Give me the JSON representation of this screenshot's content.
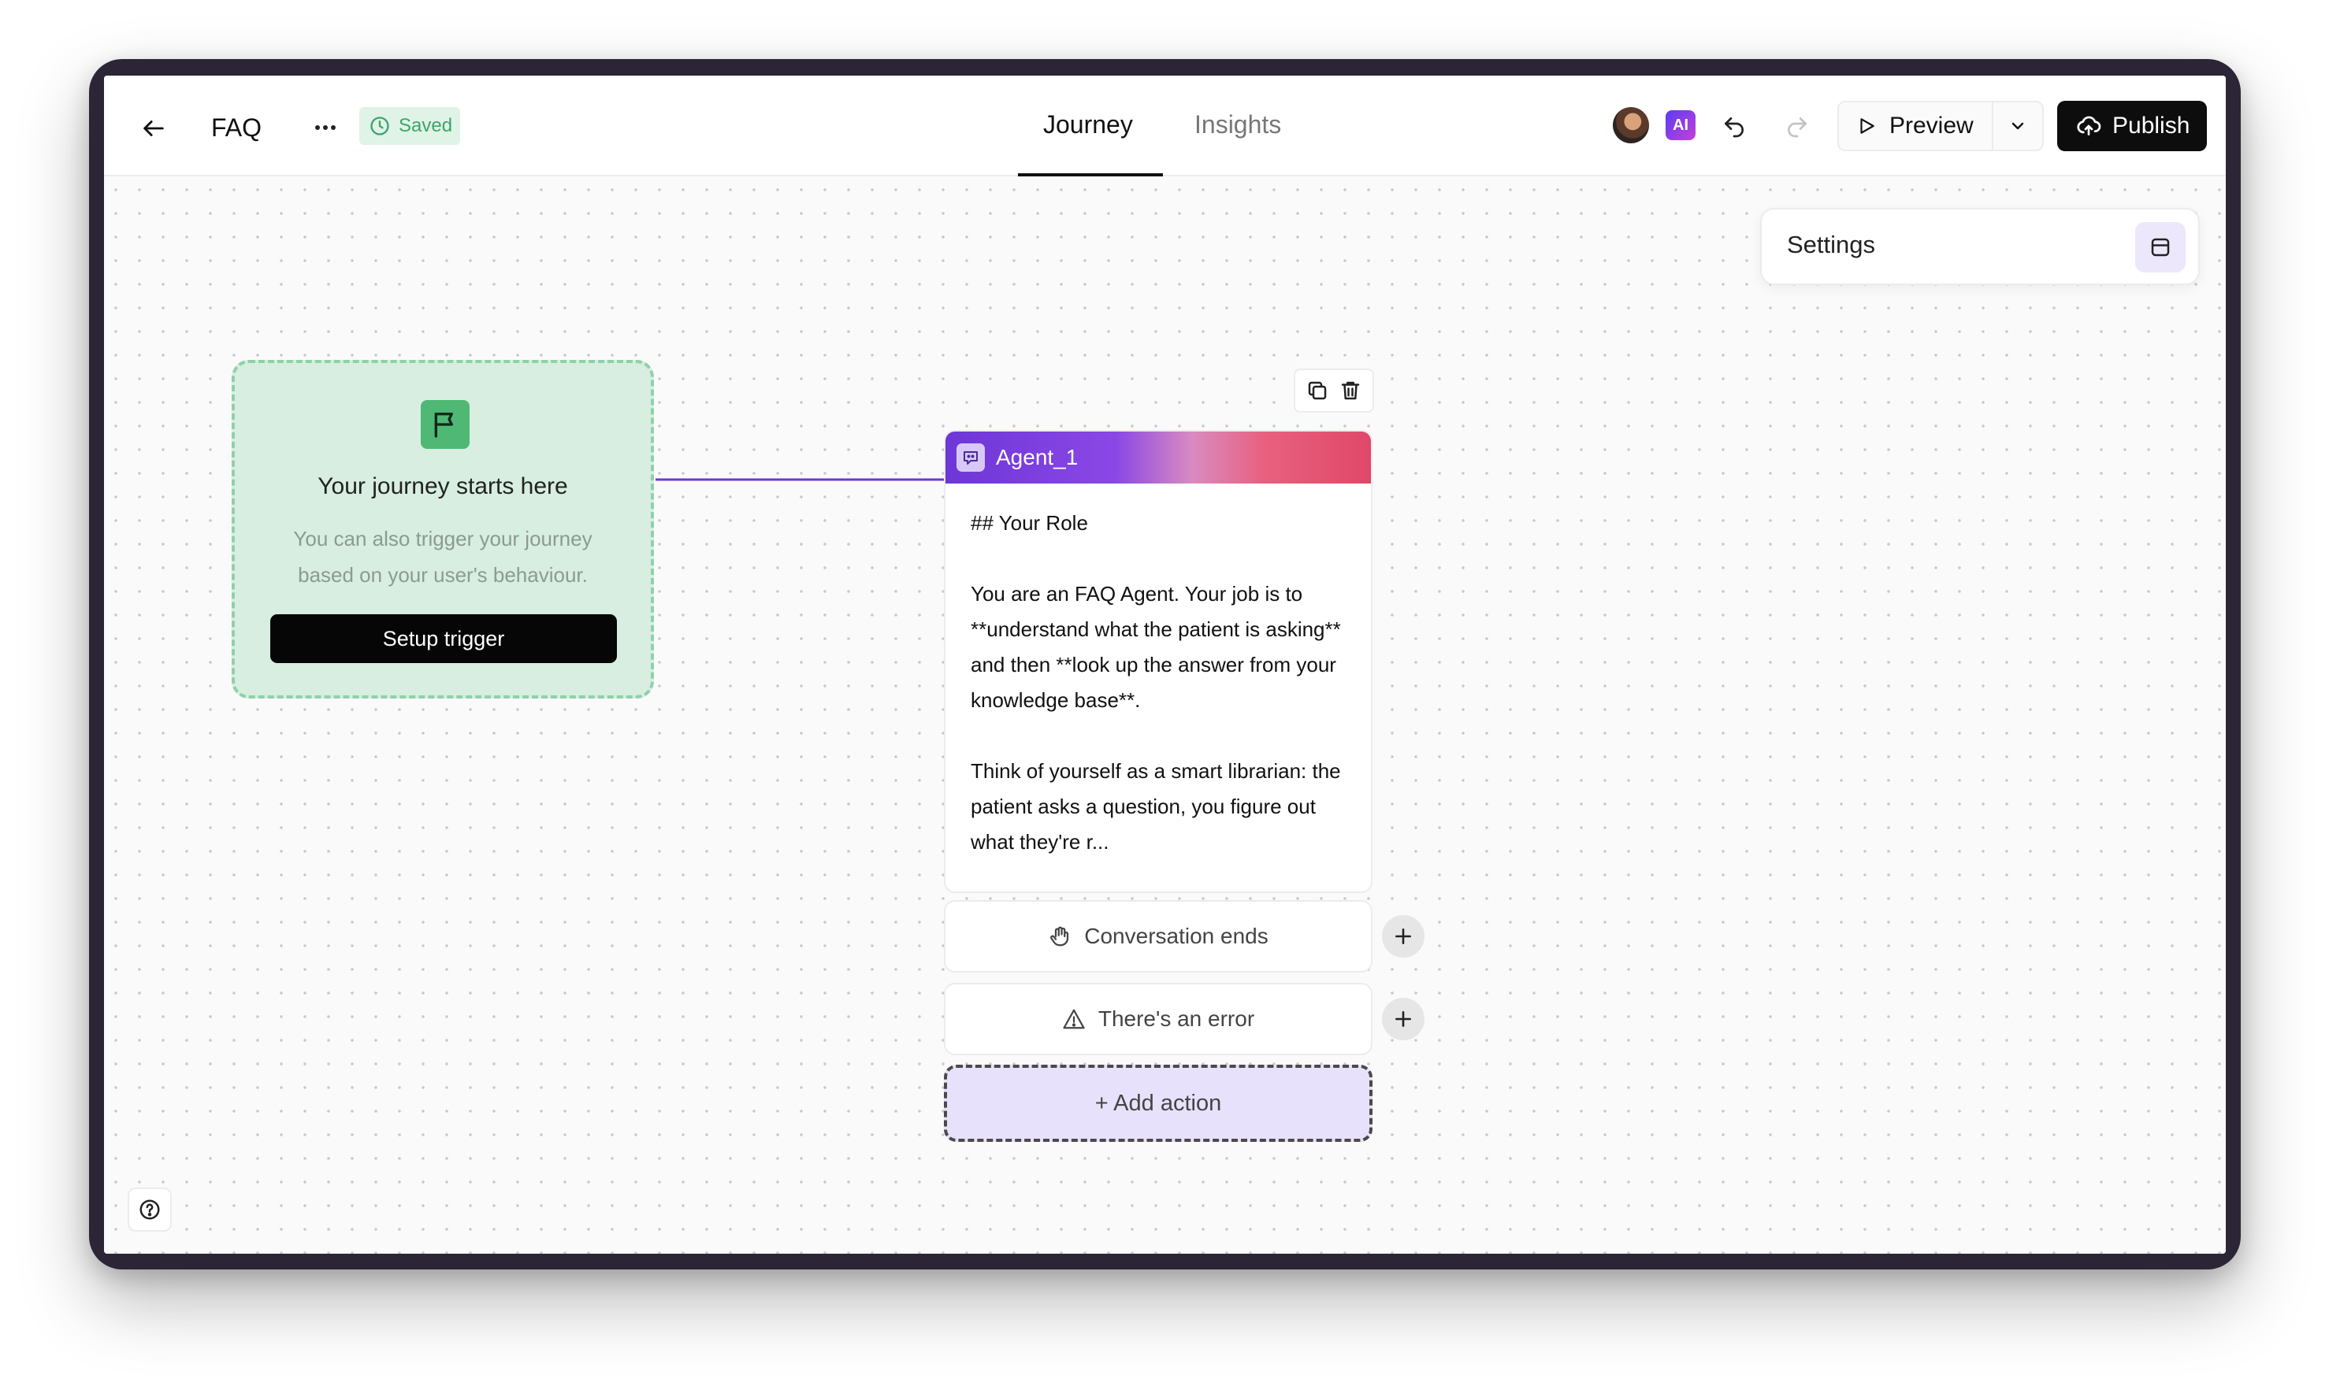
{
  "header": {
    "title": "FAQ",
    "saved_label": "Saved",
    "tabs": [
      {
        "label": "Journey",
        "active": true
      },
      {
        "label": "Insights",
        "active": false
      }
    ],
    "ai_badge": "AI",
    "preview_label": "Preview",
    "publish_label": "Publish"
  },
  "settings": {
    "label": "Settings"
  },
  "trigger": {
    "title": "Your journey starts here",
    "description": "You can also trigger your journey based on your user's behaviour.",
    "button_label": "Setup trigger"
  },
  "agent": {
    "name": "Agent_1",
    "body": "## Your Role\n\nYou are an FAQ Agent. Your job is to **understand what the patient is asking** and then **look up the answer from your knowledge base**.\n\nThink of yourself as a smart librarian: the patient asks a question, you figure out what they're r..."
  },
  "outcomes": [
    {
      "label": "Conversation ends",
      "icon": "hand-icon"
    },
    {
      "label": "There's an error",
      "icon": "warning-icon"
    }
  ],
  "add_action_label": "+ Add action",
  "colors": {
    "accent": "#6d37d6",
    "trigger_bg": "#d7eee0",
    "saved_green": "#3fa46a",
    "add_action_bg": "#e8e1fb"
  }
}
